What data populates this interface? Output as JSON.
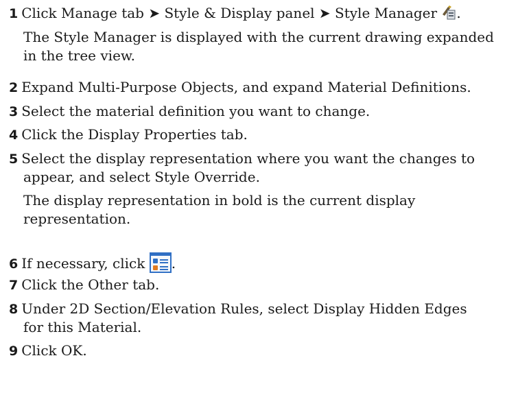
{
  "steps": [
    {
      "number": "1",
      "text": "Click Manage tab ➤ Style & Display panel ➤ Style Manager",
      "text_after_icon": ".",
      "icon": "style-manager-icon",
      "note": [
        "The Style Manager is displayed with the current drawing expanded",
        "in the tree view."
      ]
    },
    {
      "number": "2",
      "text": "Expand Multi-Purpose Objects, and expand Material Definitions."
    },
    {
      "number": "3",
      "text": "Select the material definition you want to change."
    },
    {
      "number": "4",
      "text": "Click the Display Properties tab."
    },
    {
      "number": "5",
      "text_lines": [
        "Select the display representation where you want the changes to",
        "appear, and select Style Override."
      ],
      "note": [
        "The display representation in bold is the current display",
        "representation."
      ]
    },
    {
      "number": "6",
      "text": "If necessary, click",
      "text_after_icon": ".",
      "icon": "edit-display-properties-icon"
    },
    {
      "number": "7",
      "text": "Click the Other tab."
    },
    {
      "number": "8",
      "text_lines": [
        "Under 2D Section/Elevation Rules, select Display Hidden Edges",
        "for this Material."
      ]
    },
    {
      "number": "9",
      "text": "Click OK."
    }
  ],
  "colors": {
    "text": "#1a1a1a",
    "icon_blue": "#2f6fc4",
    "icon_orange": "#e07a1f"
  }
}
